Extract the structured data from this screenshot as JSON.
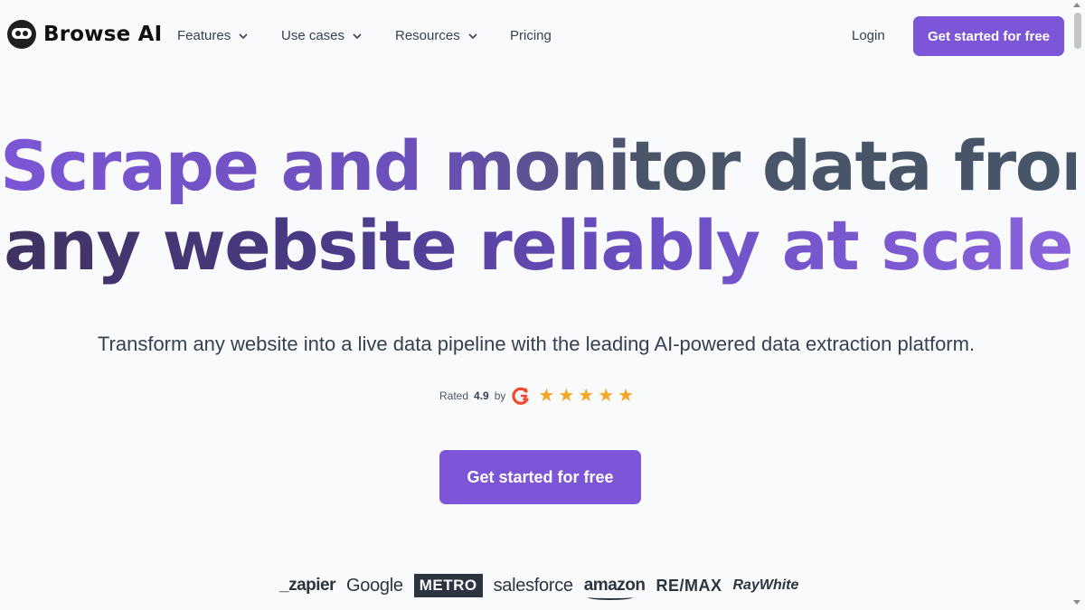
{
  "brand": {
    "name": "Browse AI"
  },
  "nav": {
    "items": [
      {
        "label": "Features",
        "has_dropdown": true
      },
      {
        "label": "Use cases",
        "has_dropdown": true
      },
      {
        "label": "Resources",
        "has_dropdown": true
      },
      {
        "label": "Pricing",
        "has_dropdown": false
      }
    ],
    "login": "Login",
    "cta": "Get started for free"
  },
  "hero": {
    "line1": {
      "a": "Scrape and",
      "b": "monitor data from"
    },
    "line2": {
      "a": "any website",
      "b": "reliably at scale"
    },
    "subtitle": "Transform any website into a live data pipeline with the leading AI-powered data extraction platform.",
    "rating": {
      "prefix": "Rated",
      "score": "4.9",
      "suffix": "by",
      "stars": 5
    },
    "cta": "Get started for free"
  },
  "logos": [
    "_zapier",
    "Google",
    "METRO",
    "salesforce",
    "amazon",
    "RE/MAX",
    "RayWhite"
  ],
  "colors": {
    "accent": "#7c56d6",
    "background": "#f8fafc",
    "star": "#f5a623",
    "g2": "#ef4a2f"
  }
}
